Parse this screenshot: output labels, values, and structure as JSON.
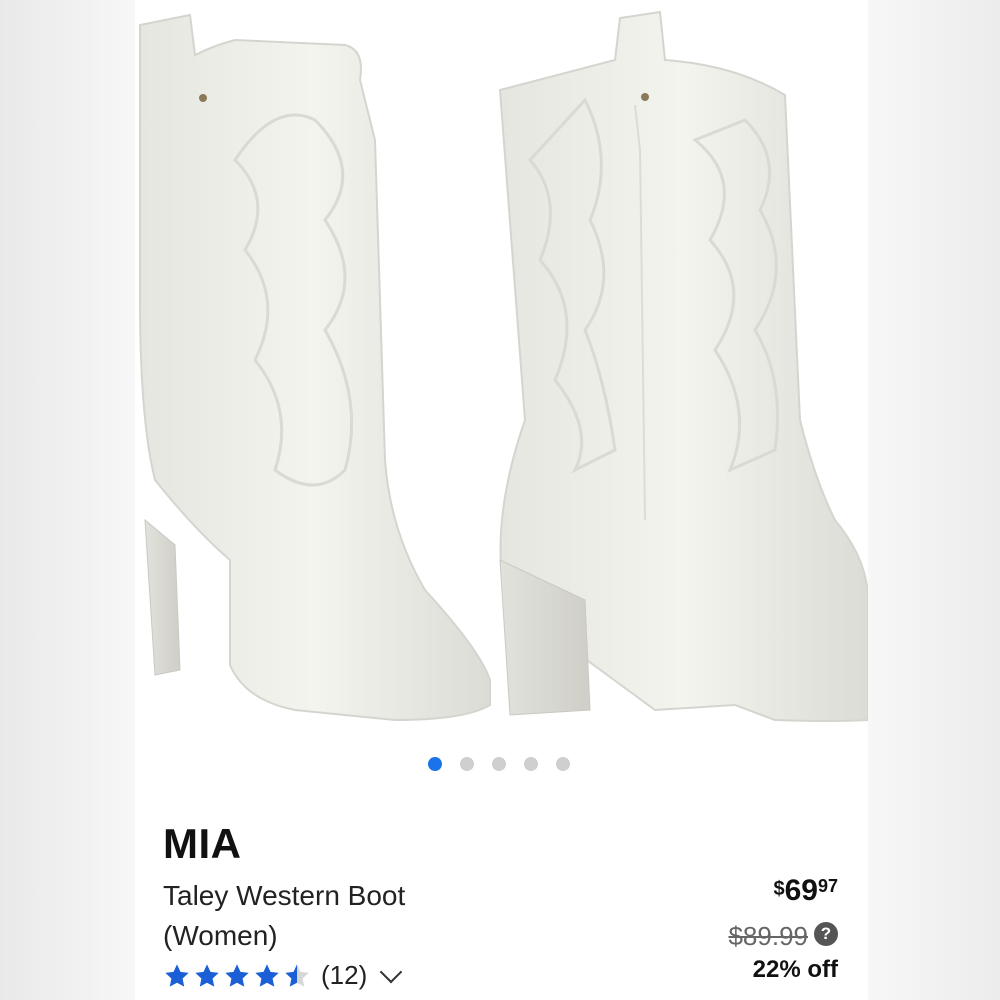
{
  "gallery": {
    "image_count": 5,
    "active_index": 0
  },
  "product": {
    "brand": "MIA",
    "title": "Taley Western Boot (Women)",
    "rating_value": 4.5,
    "review_count": "(12)",
    "price_currency": "$",
    "price_dollars": "69",
    "price_cents": "97",
    "was_price": "$89.99",
    "discount": "22% off"
  },
  "icons": {
    "star": "star-icon",
    "chevron": "chevron-down-icon",
    "help": "help-icon"
  },
  "colors": {
    "star": "#1a5fd6",
    "active_dot": "#1a73e8",
    "inactive_dot": "#cfcfcf"
  }
}
